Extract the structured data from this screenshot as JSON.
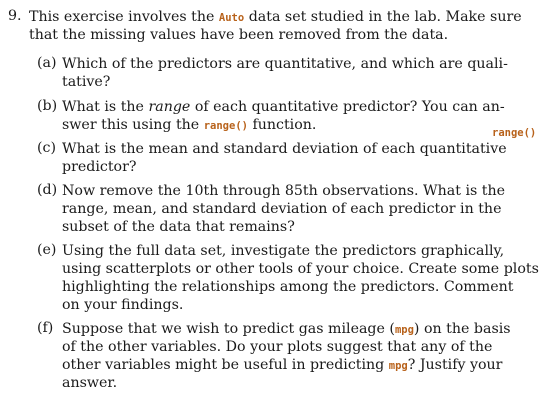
{
  "exercise": {
    "number": "9.",
    "intro_a": "This exercise involves the ",
    "dataset": "Auto",
    "intro_b": " data set studied in the lab. Make sure",
    "intro_line2": "that the missing values have been removed from the data."
  },
  "margin_note": "range()",
  "parts": [
    {
      "label": "(a)",
      "line1": "Which of the predictors are quantitative, and which are quali-",
      "line2": "tative?"
    },
    {
      "label": "(b)",
      "line1_a": "What is the ",
      "line1_em": "range",
      "line1_b": " of each quantitative predictor? You can an-",
      "line2_a": "swer this using the ",
      "line2_code": "range()",
      "line2_b": " function."
    },
    {
      "label": "(c)",
      "line1": "What is the mean and standard deviation of each quantitative",
      "line2": "predictor?"
    },
    {
      "label": "(d)",
      "line1": "Now remove the 10th through 85th observations. What is the",
      "line2": "range, mean, and standard deviation of each predictor in the",
      "line3": "subset of the data that remains?"
    },
    {
      "label": "(e)",
      "line1": "Using the full data set, investigate the predictors graphically,",
      "line2": "using scatterplots or other tools of your choice. Create some plots",
      "line3": "highlighting the relationships among the predictors. Comment",
      "line4": "on your findings."
    },
    {
      "label": "(f)",
      "line1_a": "Suppose that we wish to predict gas mileage (",
      "line1_code": "mpg",
      "line1_b": ") on the basis",
      "line2": "of the other variables. Do your plots suggest that any of the",
      "line3_a": "other variables might be useful in predicting ",
      "line3_code": "mpg",
      "line3_b": "? Justify your",
      "line4": "answer."
    }
  ]
}
